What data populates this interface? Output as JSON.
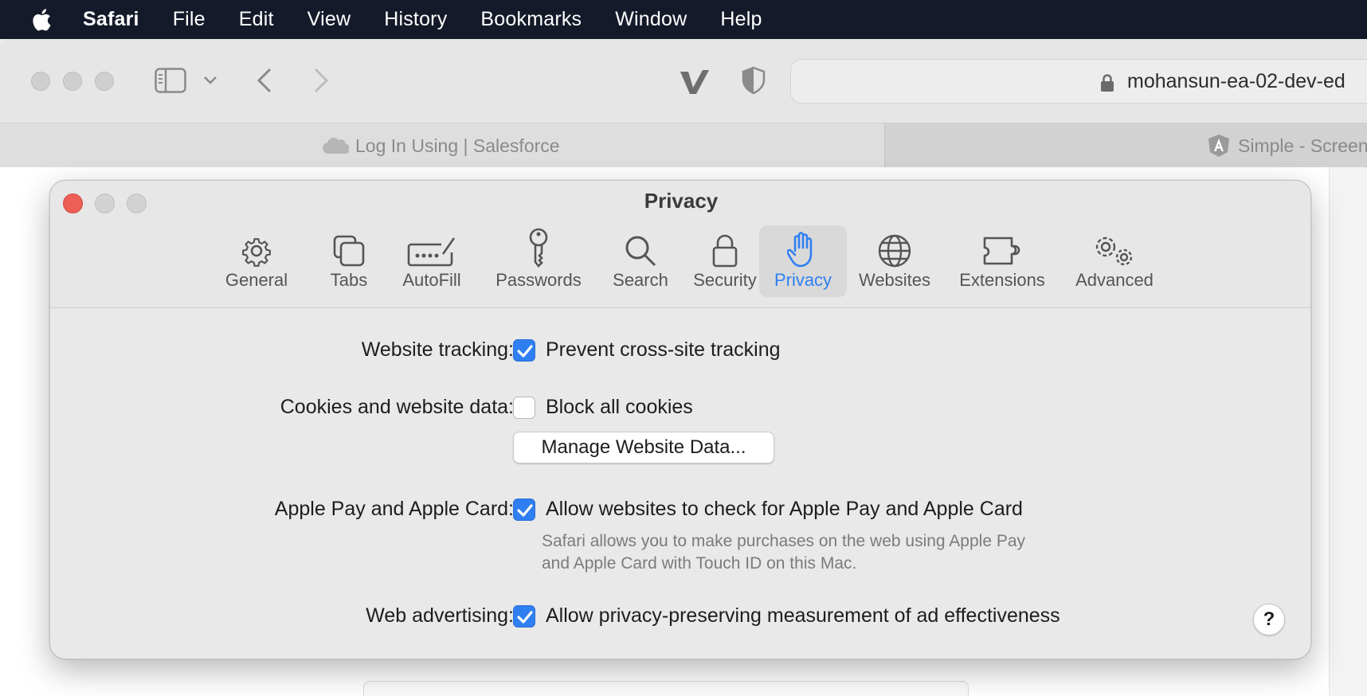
{
  "menubar": {
    "apple_icon": "apple-logo-icon",
    "items": [
      "Safari",
      "File",
      "Edit",
      "View",
      "History",
      "Bookmarks",
      "Window",
      "Help"
    ]
  },
  "browser": {
    "url": "mohansun-ea-02-dev-ed",
    "tabs": [
      {
        "label": "Log In Using | Salesforce",
        "icon": "salesforce-cloud-icon"
      },
      {
        "label": "Simple - Screen",
        "icon": "angular-icon"
      }
    ]
  },
  "prefs": {
    "title": "Privacy",
    "tabs": [
      {
        "label": "General",
        "icon": "gear-icon"
      },
      {
        "label": "Tabs",
        "icon": "tabs-icon"
      },
      {
        "label": "AutoFill",
        "icon": "autofill-icon"
      },
      {
        "label": "Passwords",
        "icon": "key-icon"
      },
      {
        "label": "Search",
        "icon": "search-icon"
      },
      {
        "label": "Security",
        "icon": "lock-icon"
      },
      {
        "label": "Privacy",
        "icon": "hand-icon"
      },
      {
        "label": "Websites",
        "icon": "globe-icon"
      },
      {
        "label": "Extensions",
        "icon": "puzzle-icon"
      },
      {
        "label": "Advanced",
        "icon": "gears-icon"
      }
    ],
    "selected_tab": "Privacy",
    "rows": {
      "tracking": {
        "label": "Website tracking:",
        "checkbox_label": "Prevent cross-site tracking",
        "checked": true
      },
      "cookies": {
        "label": "Cookies and website data:",
        "checkbox_label": "Block all cookies",
        "checked": false,
        "button_label": "Manage Website Data..."
      },
      "applepay": {
        "label": "Apple Pay and Apple Card:",
        "checkbox_label": "Allow websites to check for Apple Pay and Apple Card",
        "checked": true,
        "note_line1": "Safari allows you to make purchases on the web using Apple Pay",
        "note_line2": "and Apple Card with Touch ID on this Mac."
      },
      "advertising": {
        "label": "Web advertising:",
        "checkbox_label": "Allow privacy-preserving measurement of ad effectiveness",
        "checked": true
      }
    },
    "help_label": "?"
  },
  "colors": {
    "accent": "#2f7ff3",
    "close": "#ed5f56",
    "menubar": "#151a2a"
  }
}
